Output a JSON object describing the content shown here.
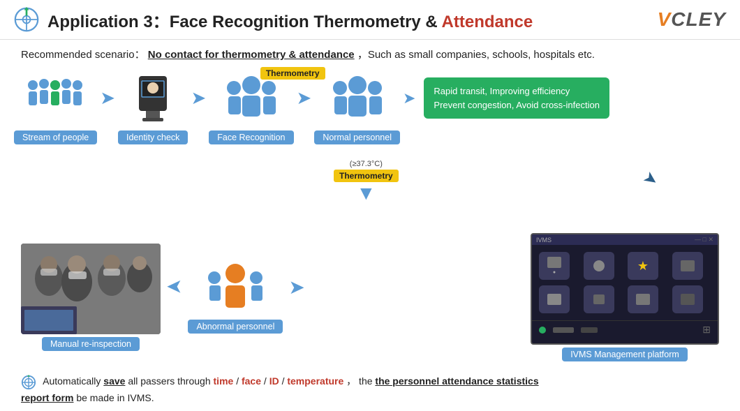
{
  "header": {
    "title_prefix": "Application 3：",
    "title_main": "Face Recognition Thermometry & ",
    "title_accent": "Attendance",
    "logo": "VCLEY"
  },
  "scenario": {
    "label": "Recommended scenario：",
    "underlined": "No contact for thermometry & attendance",
    "suffix": "，Such as small companies, schools, hospitals etc."
  },
  "flow": {
    "nodes": [
      {
        "label": "Stream of people"
      },
      {
        "label": "Identity check"
      },
      {
        "label": "Face Recognition"
      },
      {
        "label": "Normal personnel"
      }
    ],
    "thermometry_badge": "Thermometry",
    "green_box_line1": "Rapid transit, Improving efficiency",
    "green_box_line2": "Prevent congestion, Avoid cross-infection"
  },
  "bottom_flow": {
    "temp_note": "(≥37.3°C)",
    "thermo_label": "Thermometry",
    "abnormal_label": "Abnormal personnel",
    "reinspect_label": "Manual re-inspection",
    "ivms_label": "IVMS Management platform",
    "ivms_title": "IVMS"
  },
  "footer": {
    "prefix": "Automatically ",
    "save_bold": "save",
    "middle": " all passers through ",
    "time": "time",
    "slash1": " / ",
    "face": "face",
    "slash2": " / ",
    "id": "ID",
    "slash3": " / ",
    "temperature": "temperature",
    "comma": "，  the ",
    "stats_bold": "the personnel attendance statistics",
    "report_bold": "report form",
    "end": " be made in IVMS."
  }
}
